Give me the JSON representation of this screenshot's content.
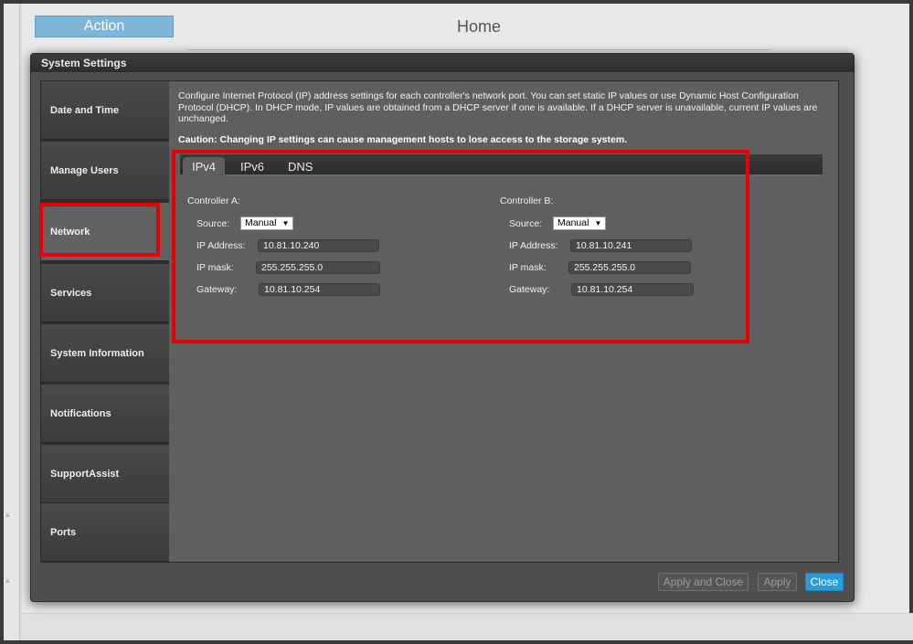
{
  "background": {
    "action_label": "Action",
    "home_title": "Home",
    "side_glyphs": [
      "≡",
      "≡"
    ]
  },
  "dialog": {
    "title": "System Settings",
    "nav_items": [
      {
        "label": "Date and Time"
      },
      {
        "label": "Manage Users"
      },
      {
        "label": "Network",
        "active": true
      },
      {
        "label": "Services"
      },
      {
        "label": "System Information"
      },
      {
        "label": "Notifications"
      },
      {
        "label": "SupportAssist"
      },
      {
        "label": "Ports"
      }
    ],
    "description": "Configure Internet Protocol (IP) address settings for each controller's network port. You can set static IP values or use Dynamic Host Configuration Protocol (DHCP). In DHCP mode, IP values are obtained from a DHCP server if one is available. If a DHCP server is unavailable, current IP values are unchanged.",
    "caution": "Caution: Changing IP settings can cause management hosts to lose access to the storage system.",
    "tabs": [
      {
        "label": "IPv4",
        "active": true
      },
      {
        "label": "IPv6"
      },
      {
        "label": "DNS"
      }
    ],
    "controller_a": {
      "title": "Controller A:",
      "source_label": "Source:",
      "source_value": "Manual",
      "ip_label": "IP Address:",
      "ip_value": "10.81.10.240",
      "mask_label": "IP mask:",
      "mask_value": "255.255.255.0",
      "gateway_label": "Gateway:",
      "gateway_value": "10.81.10.254"
    },
    "controller_b": {
      "title": "Controller B:",
      "source_label": "Source:",
      "source_value": "Manual",
      "ip_label": "IP Address:",
      "ip_value": "10.81.10.241",
      "mask_label": "IP mask:",
      "mask_value": "255.255.255.0",
      "gateway_label": "Gateway:",
      "gateway_value": "10.81.10.254"
    },
    "buttons": {
      "apply_close": "Apply and Close",
      "apply": "Apply",
      "close": "Close"
    }
  },
  "colors": {
    "highlight": "#e60000",
    "close_button": "#2a9ad8",
    "action_button": "#7eb6d8"
  }
}
